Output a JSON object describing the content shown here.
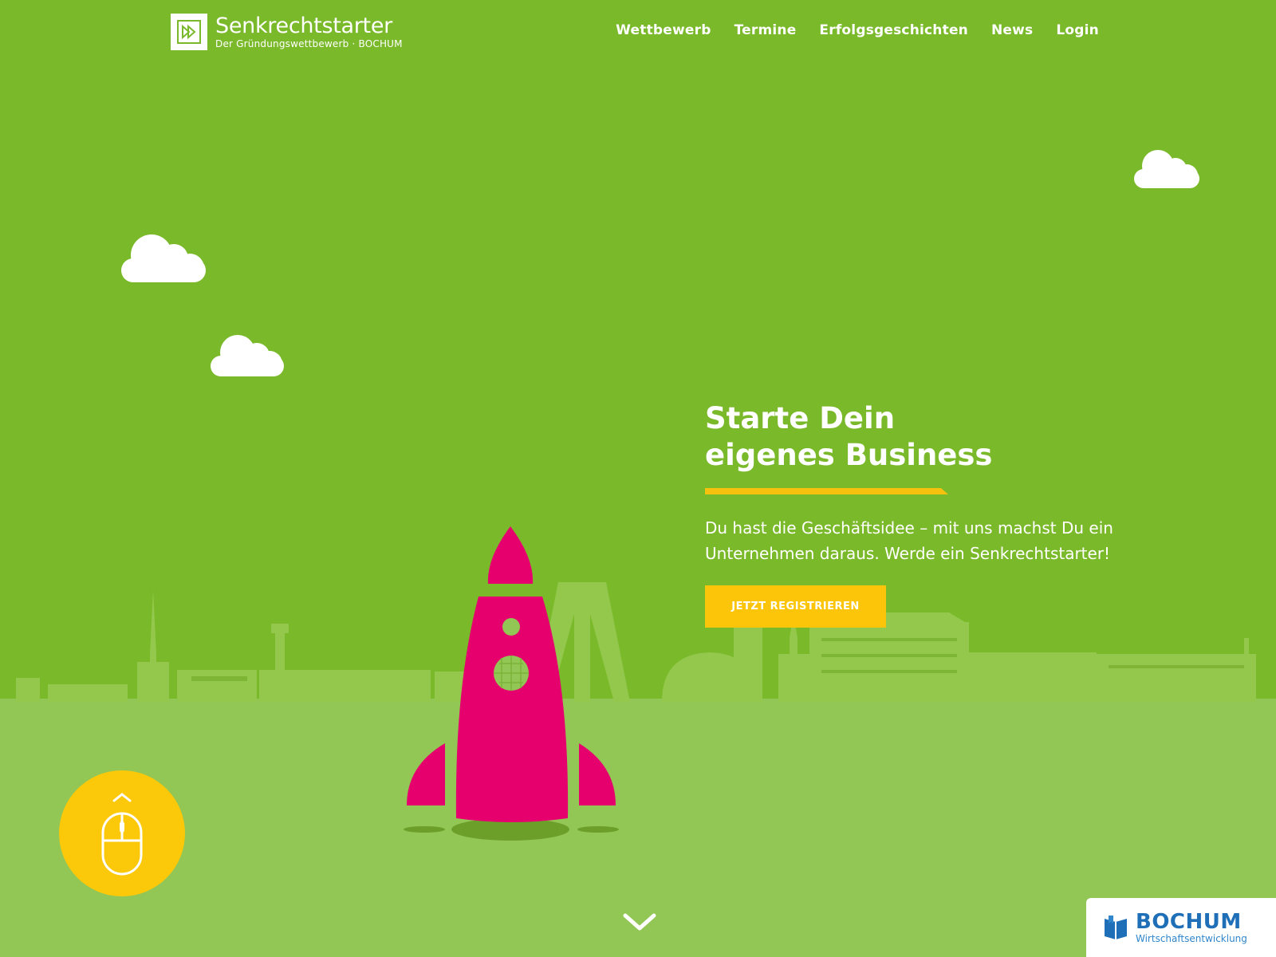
{
  "brand": {
    "title": "Senkrechtstarter",
    "subtitle": "Der Gründungswettbewerb · BOCHUM"
  },
  "nav": {
    "items": [
      {
        "label": "Wettbewerb"
      },
      {
        "label": "Termine"
      },
      {
        "label": "Erfolgsgeschichten"
      },
      {
        "label": "News"
      },
      {
        "label": "Login"
      }
    ]
  },
  "hero": {
    "heading_line1": "Starte Dein",
    "heading_line2": "eigenes Business",
    "text_line1": "Du hast die Geschäftsidee – mit uns machst Du ein",
    "text_line2": "Unternehmen daraus. Werde ein Senkrechtstarter!",
    "cta_label": "JETZT REGISTRIEREN"
  },
  "badge": {
    "title": "BOCHUM",
    "subtitle": "Wirtschaftsentwicklung"
  },
  "icons": {
    "logo": "fast-forward-icon",
    "scroll": "mouse-icon",
    "scroll_hint": "chevron-up-icon",
    "scroll_down": "chevron-down-icon",
    "badge": "book-icon"
  },
  "colors": {
    "sky": "#7aba2a",
    "ground": "#92c655",
    "accent_yellow": "#fcc509",
    "rocket_pink": "#e6006e",
    "badge_blue": "#1e6fb7"
  }
}
